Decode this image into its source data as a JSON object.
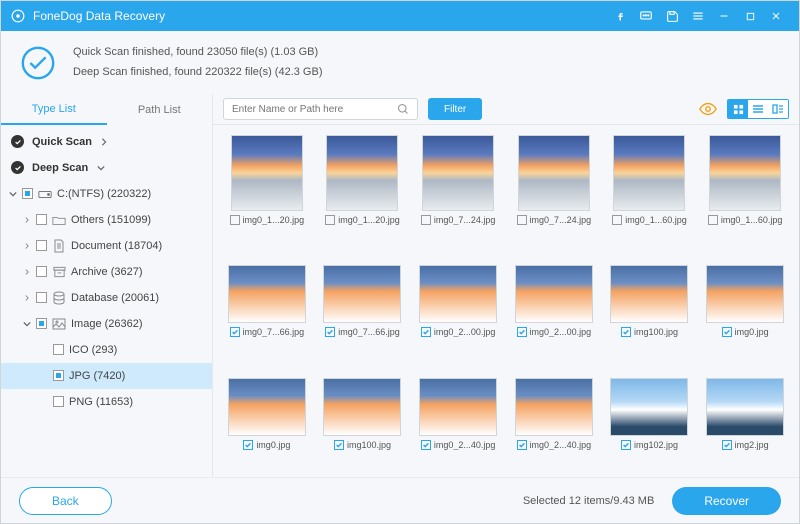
{
  "title": "FoneDog Data Recovery",
  "status": {
    "line1": "Quick Scan finished, found 23050 file(s) (1.03 GB)",
    "line2": "Deep Scan finished, found 220322 file(s) (42.3 GB)"
  },
  "tabs": {
    "type_list": "Type List",
    "path_list": "Path List"
  },
  "scan_headers": {
    "quick": "Quick Scan",
    "deep": "Deep Scan"
  },
  "tree": {
    "drive": "C:(NTFS) (220322)",
    "others": "Others (151099)",
    "document": "Document (18704)",
    "archive": "Archive (3627)",
    "database": "Database (20061)",
    "image": "Image (26362)",
    "ico": "ICO (293)",
    "jpg": "JPG (7420)",
    "png": "PNG (11653)"
  },
  "toolbar": {
    "search_placeholder": "Enter Name or Path here",
    "filter": "Filter"
  },
  "grid": [
    {
      "name": "img0_1...20.jpg",
      "checked": false,
      "v": 1
    },
    {
      "name": "img0_1...20.jpg",
      "checked": false,
      "v": 1
    },
    {
      "name": "img0_7...24.jpg",
      "checked": false,
      "v": 1
    },
    {
      "name": "img0_7...24.jpg",
      "checked": false,
      "v": 1
    },
    {
      "name": "img0_1...60.jpg",
      "checked": false,
      "v": 1
    },
    {
      "name": "img0_1...60.jpg",
      "checked": false,
      "v": 1
    },
    {
      "name": "img0_7...66.jpg",
      "checked": true,
      "v": 2
    },
    {
      "name": "img0_7...66.jpg",
      "checked": true,
      "v": 2
    },
    {
      "name": "img0_2...00.jpg",
      "checked": true,
      "v": 2
    },
    {
      "name": "img0_2...00.jpg",
      "checked": true,
      "v": 2
    },
    {
      "name": "img100.jpg",
      "checked": true,
      "v": 2
    },
    {
      "name": "img0.jpg",
      "checked": true,
      "v": 2
    },
    {
      "name": "img0.jpg",
      "checked": true,
      "v": 2
    },
    {
      "name": "img100.jpg",
      "checked": true,
      "v": 2
    },
    {
      "name": "img0_2...40.jpg",
      "checked": true,
      "v": 2
    },
    {
      "name": "img0_2...40.jpg",
      "checked": true,
      "v": 2
    },
    {
      "name": "img102.jpg",
      "checked": true,
      "v": 3
    },
    {
      "name": "img2.jpg",
      "checked": true,
      "v": 3
    }
  ],
  "footer": {
    "back": "Back",
    "selected": "Selected 12 items/9.43 MB",
    "recover": "Recover"
  }
}
